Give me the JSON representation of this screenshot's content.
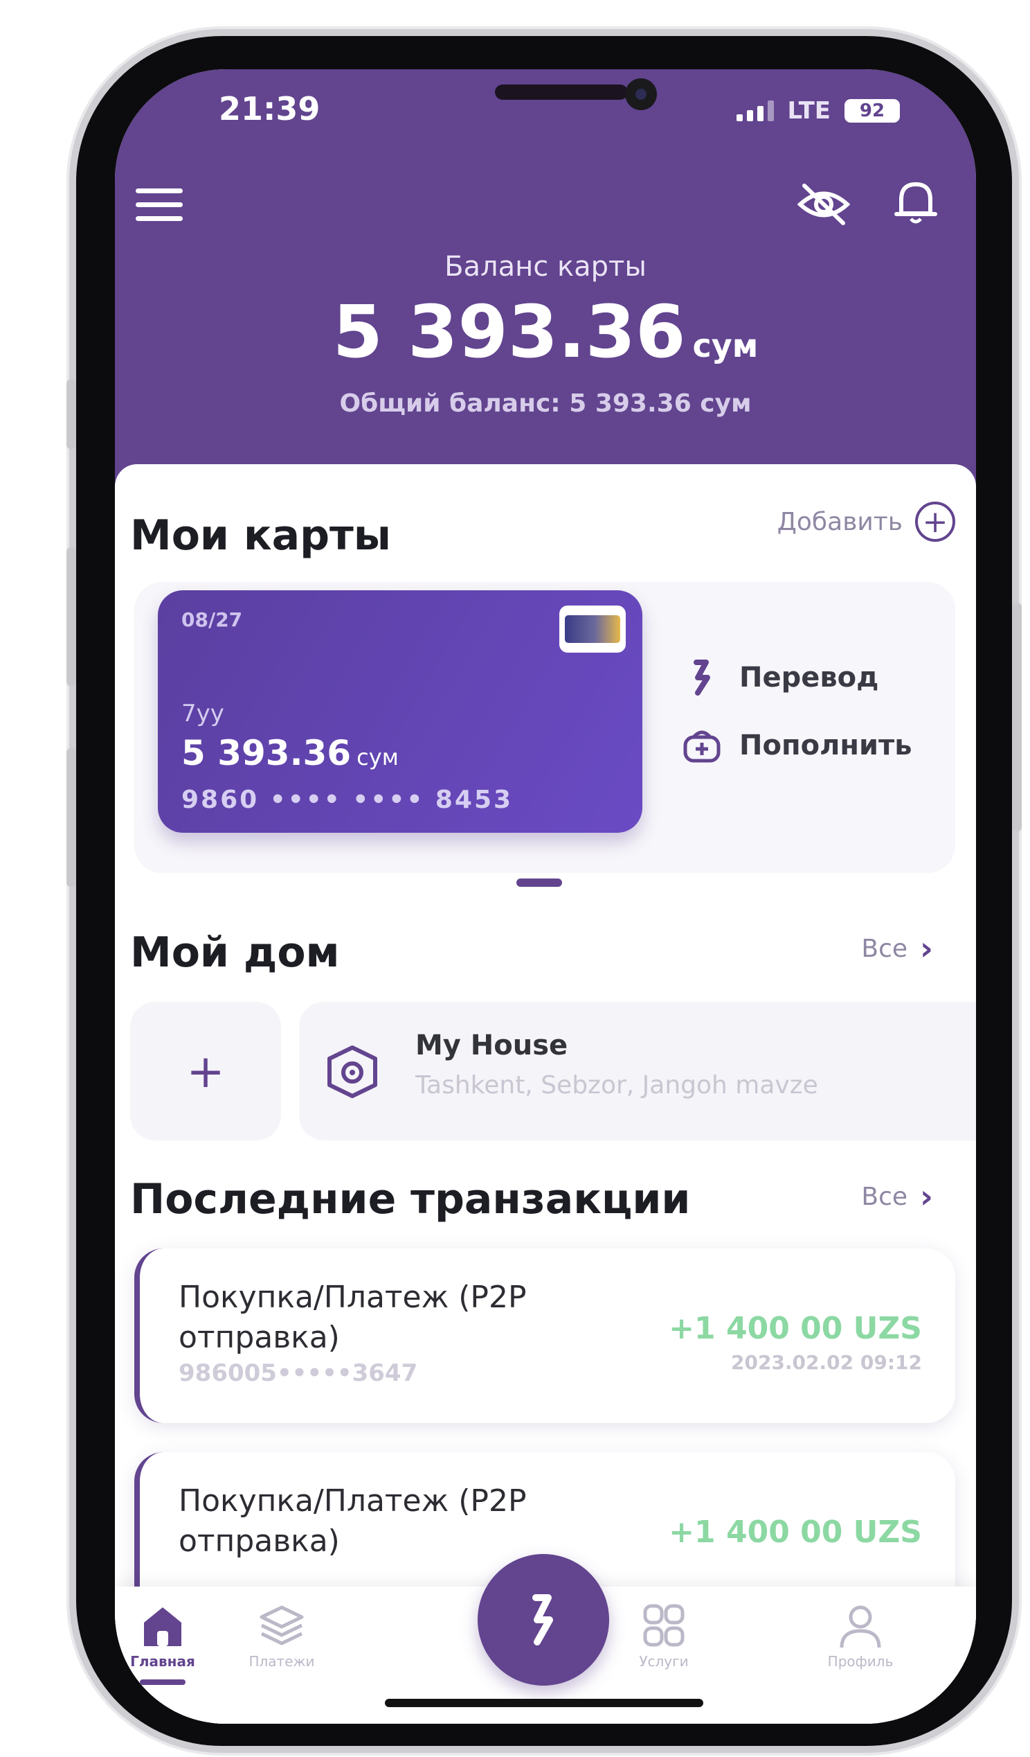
{
  "status_bar": {
    "time": "21:39",
    "network": "LTE",
    "battery": "92"
  },
  "header": {
    "balance_label": "Баланс карты",
    "balance_value": "5 393.36",
    "balance_currency": "сум",
    "total_balance": "Общий баланс: 5 393.36 сум"
  },
  "my_cards": {
    "title": "Мои карты",
    "add_label": "Добавить",
    "card": {
      "expiry": "08/27",
      "name": "7yy",
      "balance": "5 393.36",
      "currency": "сум",
      "number": "9860 •••• •••• 8453"
    },
    "actions": [
      {
        "label": "Перевод",
        "icon": "transfer-icon"
      },
      {
        "label": "Пополнить",
        "icon": "top-up-icon"
      }
    ]
  },
  "my_home": {
    "title": "Мой дом",
    "all_label": "Все",
    "add_symbol": "+",
    "house": {
      "name": "My House",
      "address": "Tashkent, Sebzor, Jangoh mavze"
    }
  },
  "transactions": {
    "title": "Последние транзакции",
    "all_label": "Все",
    "items": [
      {
        "title": "Покупка/Платеж (P2P отправка)",
        "card": "986005•••••3647",
        "amount": "+1 400 00 UZS",
        "date": "2023.02.02 09:12"
      },
      {
        "title": "Покупка/Платеж (P2P отправка)",
        "card": "",
        "amount": "+1 400 00 UZS",
        "date": ""
      }
    ]
  },
  "tabbar": {
    "tabs": [
      {
        "label": "Главная",
        "icon": "home-icon",
        "active": true
      },
      {
        "label": "Платежи",
        "icon": "layers-icon",
        "active": false
      },
      {
        "label": "Услуги",
        "icon": "grid-icon",
        "active": false
      },
      {
        "label": "Профиль",
        "icon": "user-icon",
        "active": false
      }
    ],
    "center_action_icon": "transfer-icon"
  },
  "colors": {
    "primary": "#62448f",
    "positive_amount": "#8cd8a3"
  }
}
